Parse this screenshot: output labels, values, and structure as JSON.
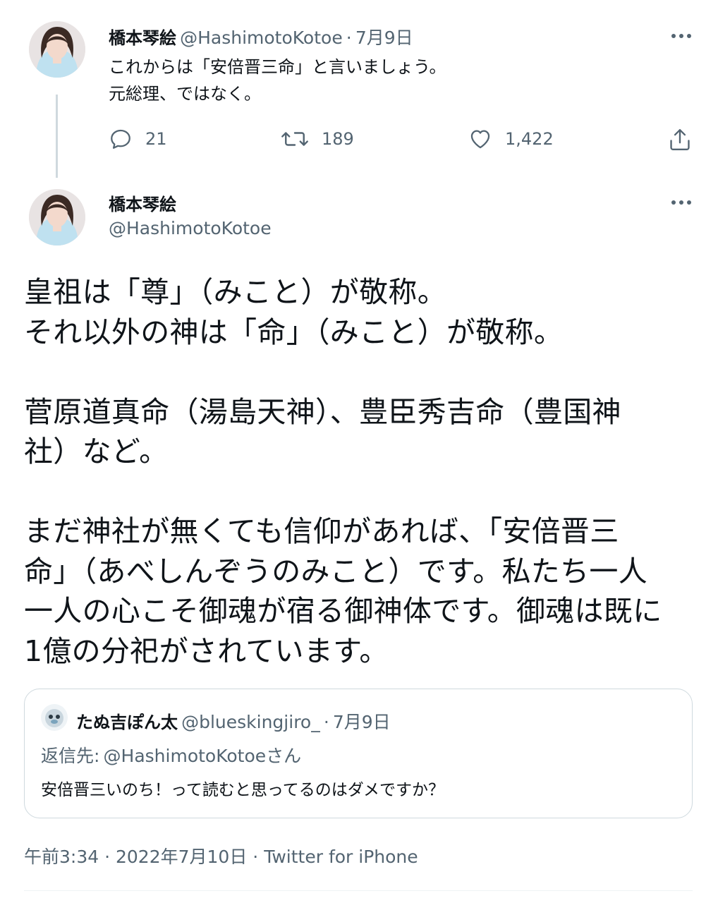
{
  "tweet1": {
    "author_name": "橋本琴絵",
    "handle": "@HashimotoKotoe",
    "separator": "·",
    "date": "7月9日",
    "text": "これからは「安倍晋三命」と言いましょう。\n元総理、ではなく。",
    "replies": "21",
    "retweets": "189",
    "likes": "1,422"
  },
  "tweet2": {
    "author_name": "橋本琴絵",
    "handle": "@HashimotoKotoe",
    "text": "皇祖は「尊」（みこと）が敬称。\nそれ以外の神は「命」（みこと）が敬称。\n\n菅原道真命（湯島天神）、豊臣秀吉命（豊国神\n社）など。\n\nまだ神社が無くても信仰があれば、「安倍晋三\n命」（あべしんぞうのみこと）です。私たち一人\n一人の心こそ御魂が宿る御神体です。御魂は既に\n1億の分祀がされています。",
    "timestamp": "午前3:34",
    "date_full": "2022年7月10日",
    "source": "Twitter for iPhone"
  },
  "quote": {
    "author_name": "たぬ吉ぽん太",
    "handle": "@blueskingjiro_",
    "date": "7月9日",
    "reply_label": "返信先:",
    "reply_to": "@HashimotoKotoeさん",
    "text": "安倍晋三いのち！って読むと思ってるのはダメですか？"
  },
  "colors": {
    "text_primary": "#0f1419",
    "text_secondary": "#536471",
    "border": "#cfd9de"
  },
  "icons": [
    "more-icon",
    "reply-icon",
    "retweet-icon",
    "like-icon",
    "share-icon",
    "avatar-photo"
  ]
}
